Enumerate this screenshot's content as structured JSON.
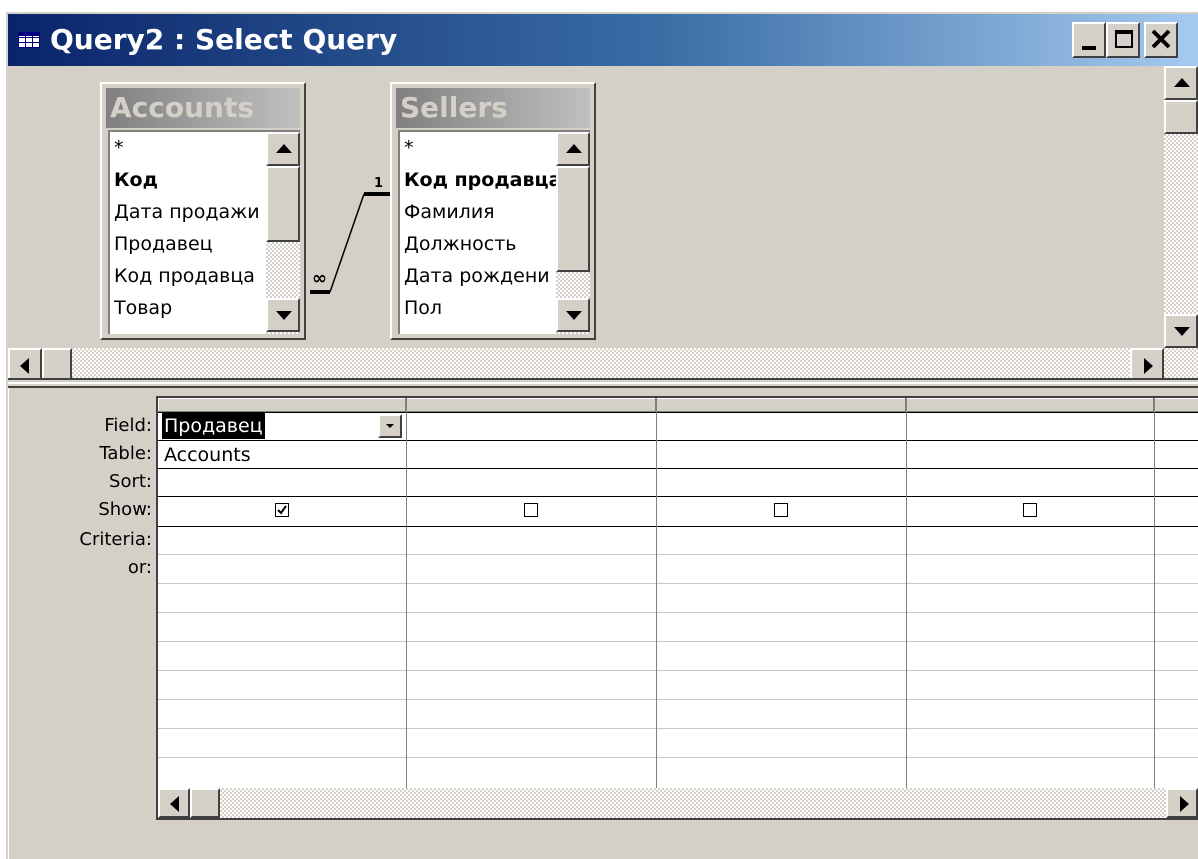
{
  "window": {
    "title": "Query2 : Select Query",
    "icon": "query-icon",
    "title_gradient": [
      "#0a246a",
      "#a6caf0"
    ],
    "buttons": [
      "minimize-icon",
      "maximize-icon",
      "close-icon"
    ]
  },
  "tables": [
    {
      "name": "Accounts",
      "fields": [
        {
          "label": "*",
          "bold": false
        },
        {
          "label": "Код",
          "bold": true
        },
        {
          "label": "Дата продажи",
          "bold": false
        },
        {
          "label": "Продавец",
          "bold": false
        },
        {
          "label": "Код продавца",
          "bold": false
        },
        {
          "label": "Товар",
          "bold": false
        }
      ]
    },
    {
      "name": "Sellers",
      "fields": [
        {
          "label": "*",
          "bold": false
        },
        {
          "label": "Код продавца",
          "bold": true
        },
        {
          "label": "Фамилия",
          "bold": false
        },
        {
          "label": "Должность",
          "bold": false
        },
        {
          "label": "Дата рождени",
          "bold": false
        },
        {
          "label": "Пол",
          "bold": false
        }
      ]
    }
  ],
  "relationship": {
    "many_label": "∞",
    "one_label": "1"
  },
  "grid": {
    "row_labels": [
      "Field:",
      "Table:",
      "Sort:",
      "Show:",
      "Criteria:",
      "or:"
    ],
    "columns": [
      {
        "field": "Продавец",
        "table": "Accounts",
        "sort": "",
        "show": true
      },
      {
        "field": "",
        "table": "",
        "sort": "",
        "show": false
      },
      {
        "field": "",
        "table": "",
        "sort": "",
        "show": false
      },
      {
        "field": "",
        "table": "",
        "sort": "",
        "show": false
      }
    ]
  }
}
